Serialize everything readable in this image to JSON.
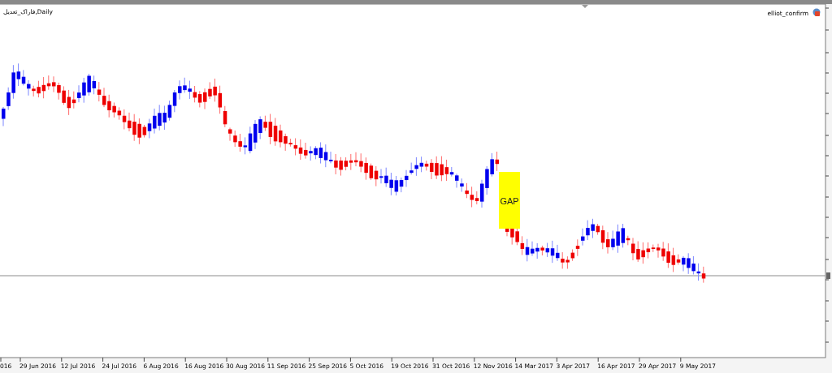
{
  "chart": {
    "title": "فاراک_تعدیل,Daily",
    "expert_label": "elliot_confirm",
    "annotation": "GAP",
    "time_axis": [
      "016",
      "29 Jun 2016",
      "12 Jul 2016",
      "24 Jul 2016",
      "6 Aug 2016",
      "16 Aug 2016",
      "30 Aug 2016",
      "11 Sep 2016",
      "25 Sep 2016",
      "5 Oct 2016",
      "19 Oct 2016",
      "31 Oct 2016",
      "12 Nov 2016",
      "14 Mar 2017",
      "3 Apr 2017",
      "16 Apr 2017",
      "29 Apr 2017",
      "9 May 2017"
    ]
  }
}
